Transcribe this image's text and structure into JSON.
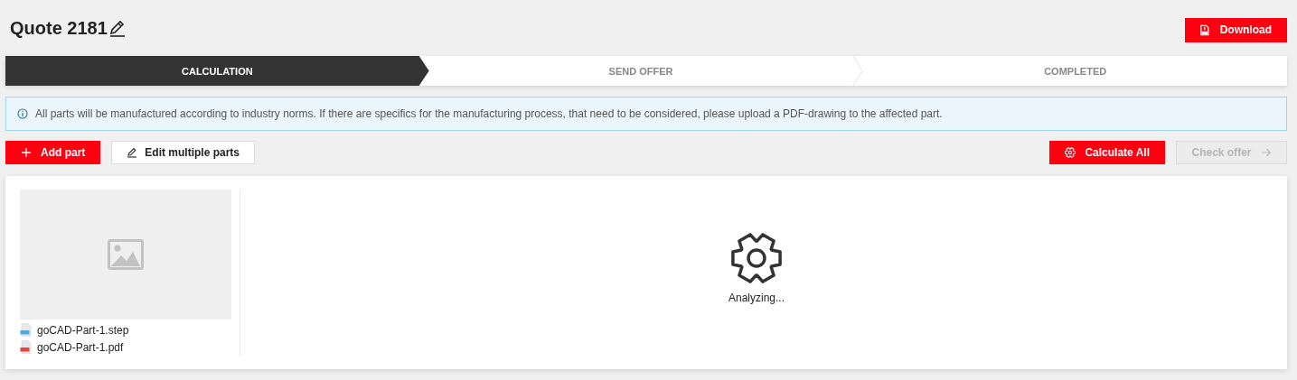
{
  "title": "Quote 2181",
  "download": {
    "label": "Download"
  },
  "steps": [
    {
      "label": "CALCULATION",
      "selected": true
    },
    {
      "label": "SEND OFFER",
      "selected": false
    },
    {
      "label": "COMPLETED",
      "selected": false
    }
  ],
  "info": "All parts will be manufactured according to industry norms. If there are specifics for the manufacturing process, that need to be considered, please upload a PDF-drawing to the affected part.",
  "actions_left": [
    {
      "label": "Add part",
      "kind": "add",
      "disabled": false
    },
    {
      "label": "Edit multiple parts",
      "kind": "edit",
      "disabled": false
    }
  ],
  "actions_right": [
    {
      "label": "Calculate All",
      "kind": "calculate",
      "disabled": false
    },
    {
      "label": "Check offer",
      "kind": "next",
      "disabled": true
    }
  ],
  "part": {
    "files": [
      {
        "name": "goCAD-Part-1.step",
        "kind": "step"
      },
      {
        "name": "goCAD-Part-1.pdf",
        "kind": "pdf"
      }
    ],
    "status": "Analyzing..."
  }
}
